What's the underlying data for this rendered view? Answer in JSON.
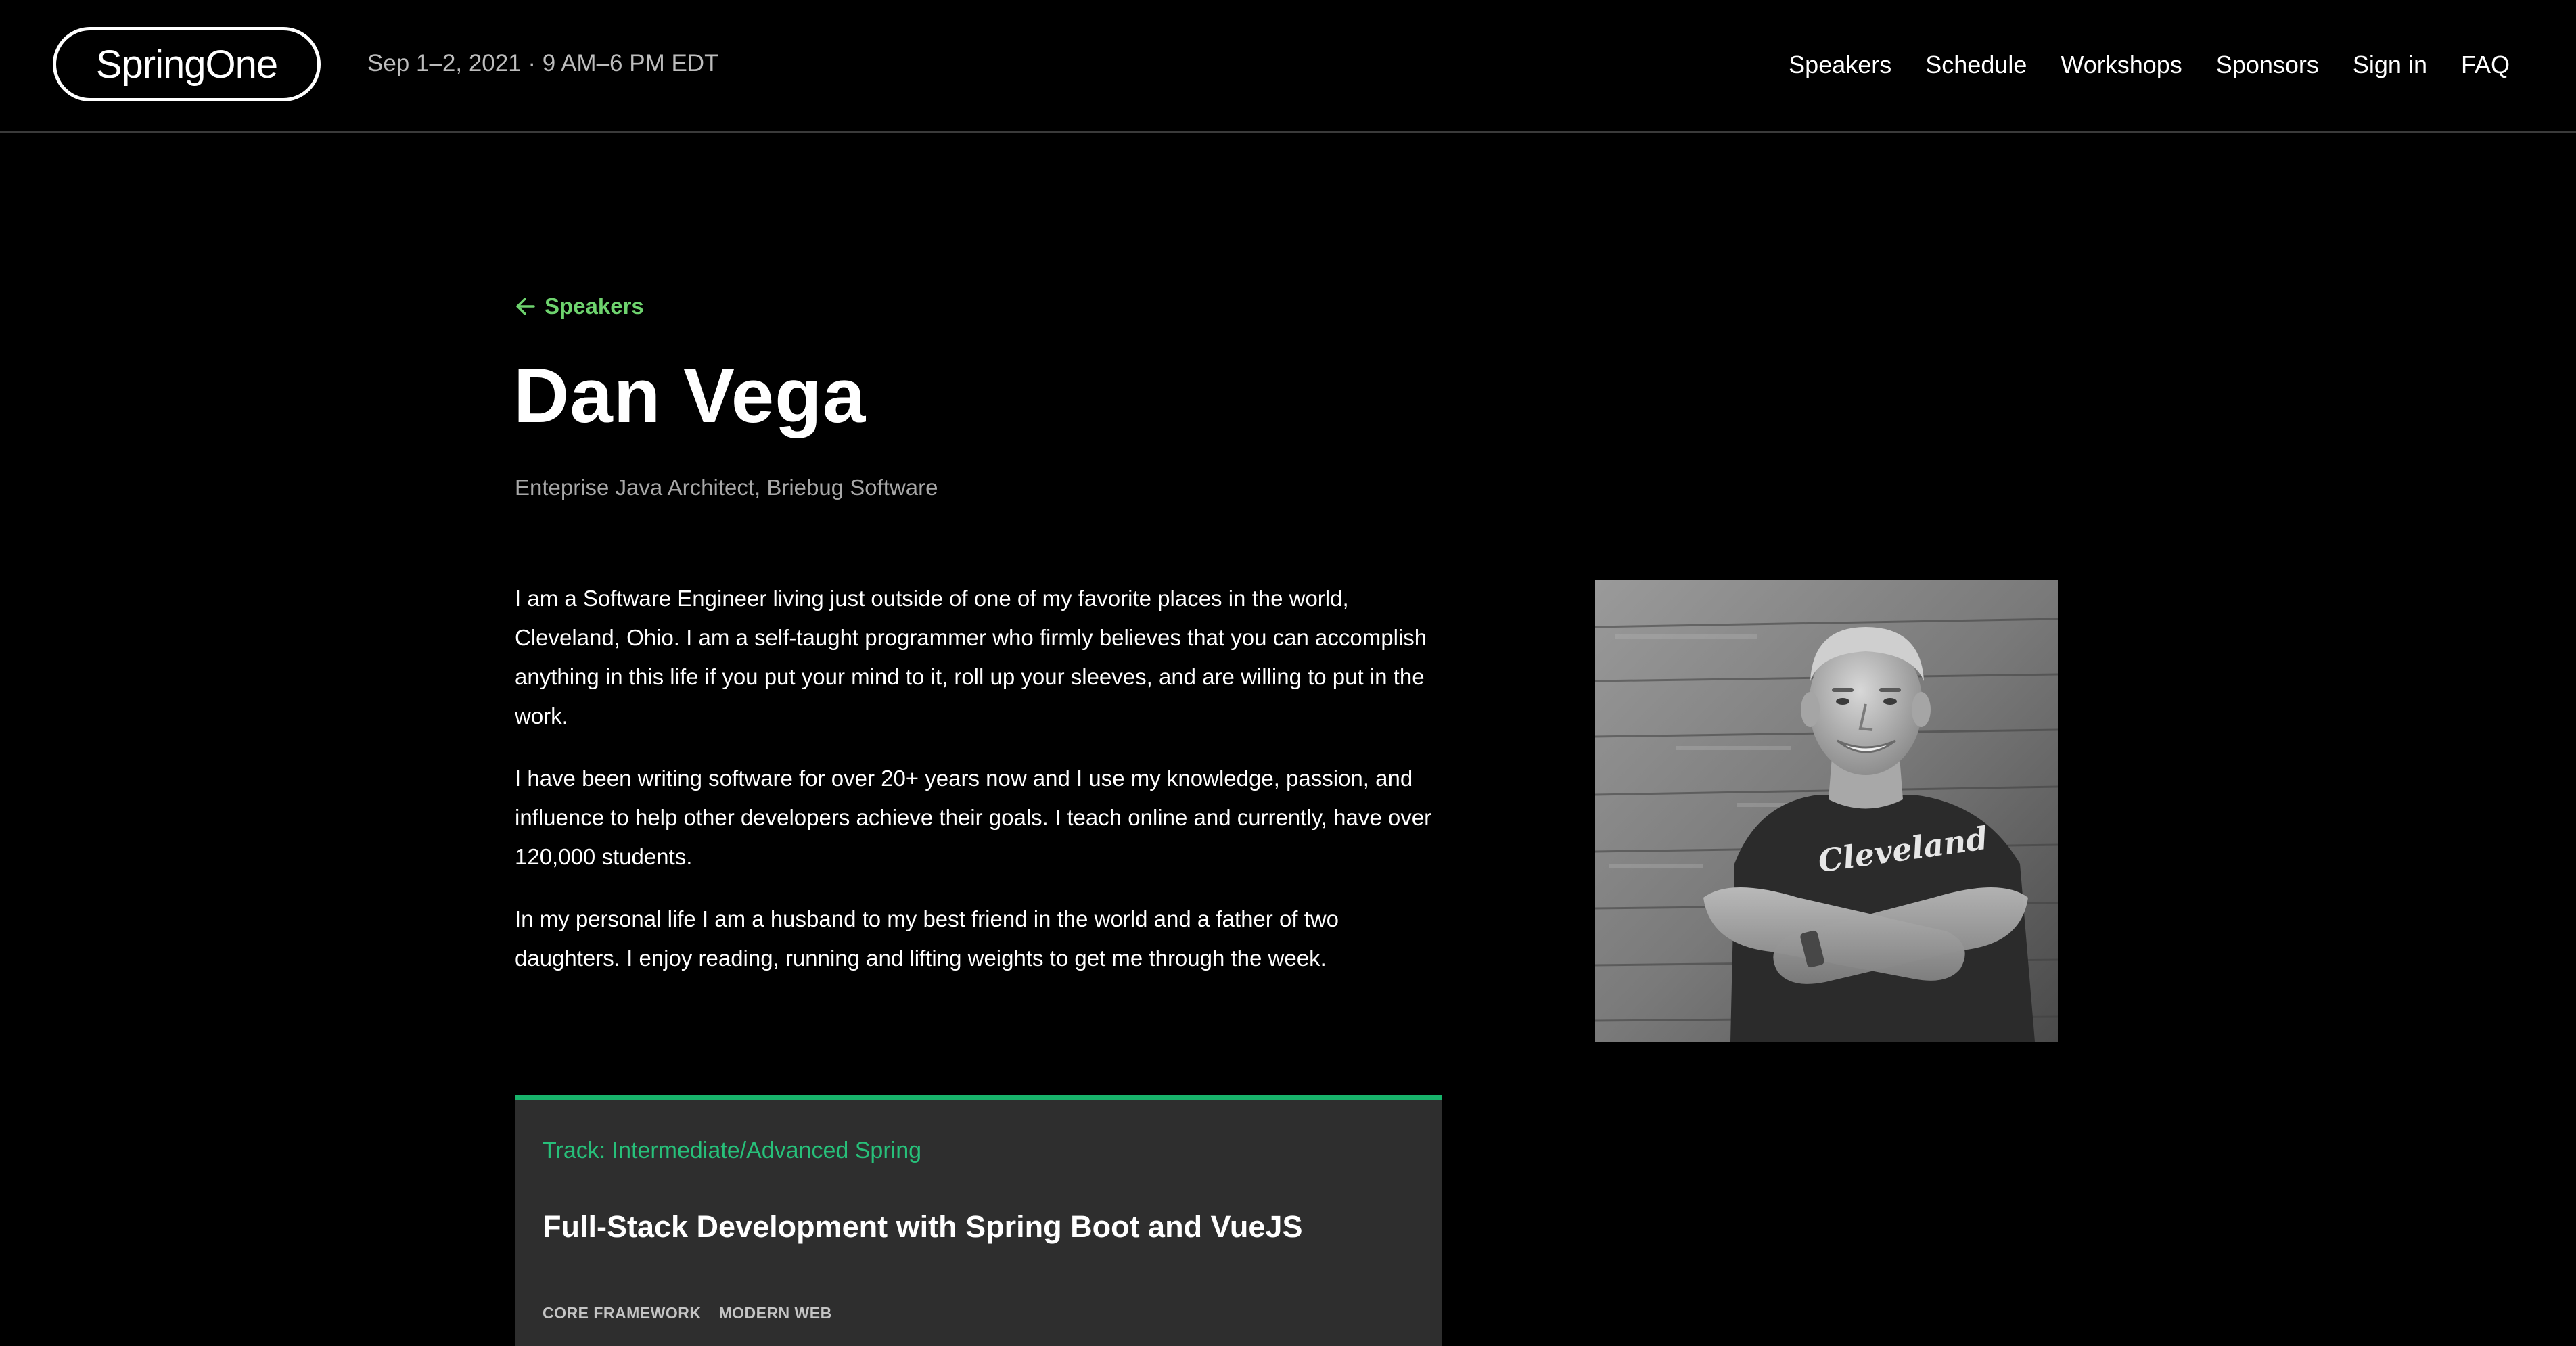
{
  "header": {
    "logo_text": "SpringOne",
    "event_date": "Sep 1–2, 2021 · 9 AM–6 PM EDT",
    "nav": [
      {
        "label": "Speakers"
      },
      {
        "label": "Schedule"
      },
      {
        "label": "Workshops"
      },
      {
        "label": "Sponsors"
      },
      {
        "label": "Sign in"
      },
      {
        "label": "FAQ"
      }
    ]
  },
  "back_link": {
    "label": "Speakers",
    "icon": "arrow-left-icon"
  },
  "speaker": {
    "name": "Dan Vega",
    "title": "Enteprise Java Architect, Briebug Software",
    "bio": [
      "I am a Software Engineer living just outside of one of my favorite places in the world, Cleveland, Ohio. I am a self-taught programmer who firmly believes that you can accomplish anything in this life if you put your mind to it, roll up your sleeves, and are willing to put in the work.",
      "I have been writing software for over 20+ years now and I use my knowledge, passion, and influence to help other developers achieve their goals. I teach online and currently, have over 120,000 students.",
      "In my personal life I am a husband to my best friend in the world and a father of two daughters. I enjoy reading, running and lifting weights to get me through the week."
    ],
    "photo_shirt_text": "Cleveland"
  },
  "session": {
    "track": "Track: Intermediate/Advanced Spring",
    "title": "Full-Stack Development with Spring Boot and VueJS",
    "tags": [
      "CORE FRAMEWORK",
      "MODERN WEB"
    ]
  },
  "colors": {
    "background": "#000000",
    "accent_green": "#6ed36e",
    "track_green": "#27c07a",
    "card_border": "#18b36b",
    "card_background": "#2e2e2e"
  }
}
